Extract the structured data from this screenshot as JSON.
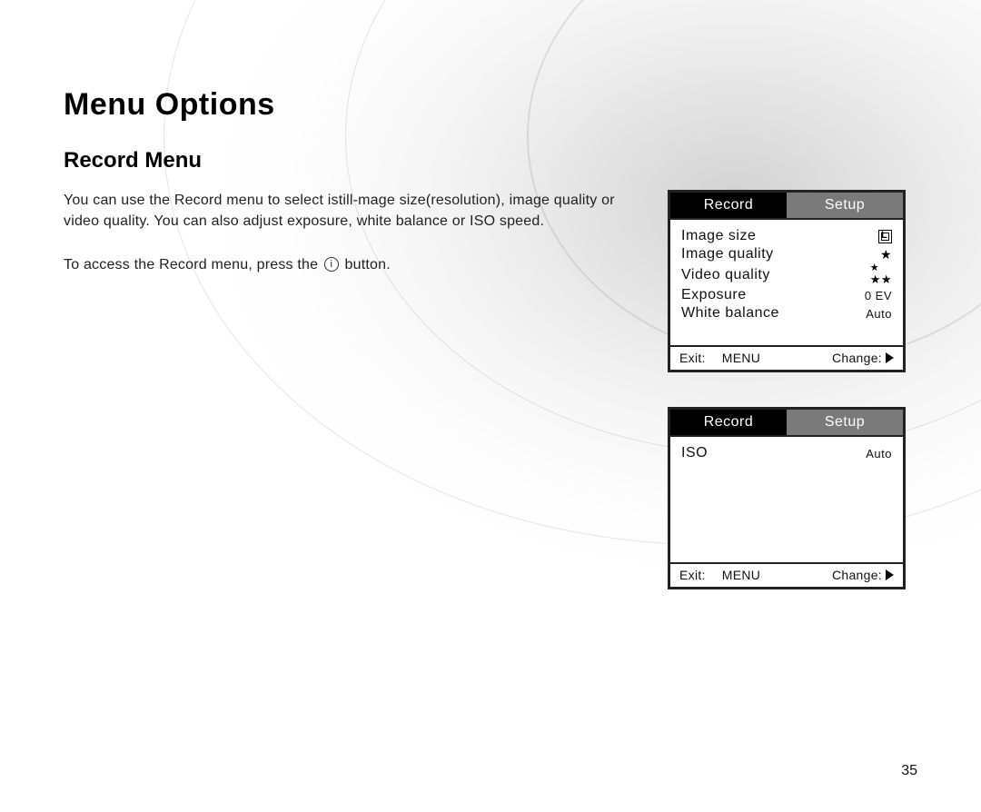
{
  "page_number": "35",
  "title": "Menu Options",
  "section_heading": "Record Menu",
  "paragraph1": "You can use the Record menu to select istill-mage size(resolution), image quality or video quality. You can also adjust exposure, white balance or ISO speed.",
  "paragraph2_prefix": "To access the Record menu, press the ",
  "paragraph2_suffix": " button.",
  "info_icon_glyph": "i",
  "screen1": {
    "tabs": {
      "active": "Record",
      "inactive": "Setup"
    },
    "items": [
      {
        "label": "Image size",
        "value_icon": "size-box"
      },
      {
        "label": "Image quality",
        "value_icon": "star-1"
      },
      {
        "label": "Video quality",
        "value_icon": "star-2"
      },
      {
        "label": "Exposure",
        "value_text": "0 EV"
      },
      {
        "label": "White balance",
        "value_text": "Auto"
      }
    ],
    "footer": {
      "exit": "Exit:",
      "menu": "MENU",
      "change": "Change:"
    }
  },
  "screen2": {
    "tabs": {
      "active": "Record",
      "inactive": "Setup"
    },
    "items": [
      {
        "label": "ISO",
        "value_text": "Auto"
      }
    ],
    "footer": {
      "exit": "Exit:",
      "menu": "MENU",
      "change": "Change:"
    }
  }
}
